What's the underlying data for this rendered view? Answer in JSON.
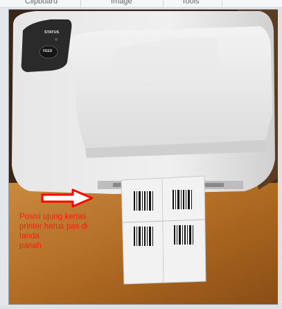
{
  "ribbon": {
    "groups": [
      "Clipboard",
      "Image",
      "Tools"
    ]
  },
  "photo": {
    "printer": {
      "status_label": "STATUS",
      "feed_label": "FEED"
    },
    "annotation": "Posisi ujung kertas printer harus pas di tanda\npanah",
    "arrow_color": "#ff0000",
    "text_color": "#ff1a1a"
  }
}
